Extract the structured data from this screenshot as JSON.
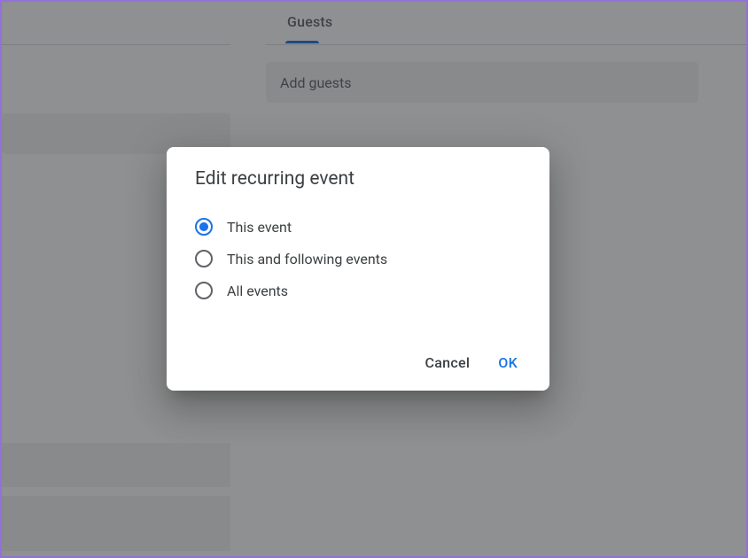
{
  "tabs": {
    "active": "Guests"
  },
  "guests": {
    "placeholder": "Add guests"
  },
  "dialog": {
    "title": "Edit recurring event",
    "options": {
      "this": "This event",
      "following": "This and following events",
      "all": "All events"
    },
    "selectedIndex": 0,
    "actions": {
      "cancel": "Cancel",
      "ok": "OK"
    }
  }
}
